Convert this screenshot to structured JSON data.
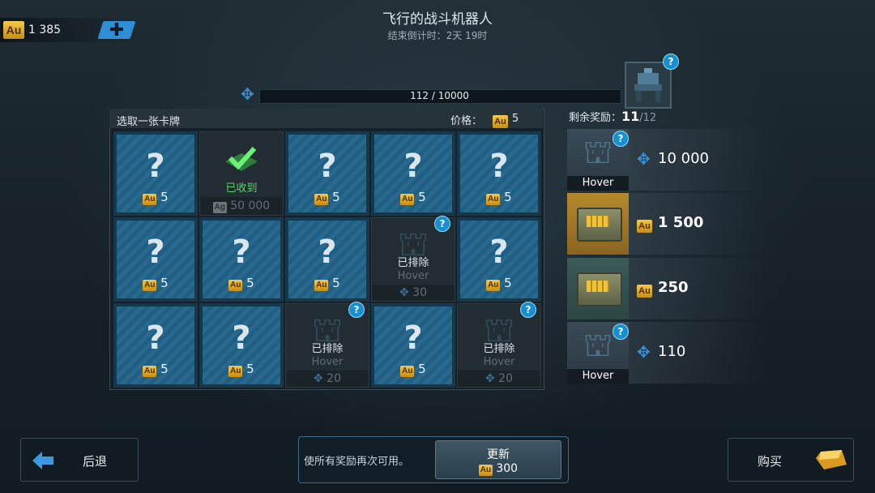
{
  "header": {
    "currency_icon": "Au",
    "currency_amount": "1 385",
    "plus_icon": "plus-icon",
    "title": "飞行的战斗机器人",
    "countdown": "结束倒计时：2天 19时"
  },
  "progress": {
    "text": "112 / 10000",
    "current": 112,
    "max": 10000,
    "icon": "puzzle-piece-icon"
  },
  "card_panel": {
    "title": "选取一张卡牌",
    "price_label": "价格：",
    "price_value": "5",
    "cards": [
      {
        "type": "hidden",
        "cost": "5"
      },
      {
        "type": "collected",
        "label": "已收到",
        "value": "50 000",
        "currency": "Ag"
      },
      {
        "type": "hidden",
        "cost": "5"
      },
      {
        "type": "hidden",
        "cost": "5"
      },
      {
        "type": "hidden",
        "cost": "5"
      },
      {
        "type": "hidden",
        "cost": "5"
      },
      {
        "type": "hidden",
        "cost": "5"
      },
      {
        "type": "hidden",
        "cost": "5"
      },
      {
        "type": "excluded",
        "label": "已排除",
        "name": "Hover",
        "count": "30"
      },
      {
        "type": "hidden",
        "cost": "5"
      },
      {
        "type": "hidden",
        "cost": "5"
      },
      {
        "type": "hidden",
        "cost": "5"
      },
      {
        "type": "excluded",
        "label": "已排除",
        "name": "Hover",
        "count": "20"
      },
      {
        "type": "hidden",
        "cost": "5"
      },
      {
        "type": "excluded",
        "label": "已排除",
        "name": "Hover",
        "count": "20"
      }
    ]
  },
  "rewards": {
    "remaining_label": "剩余奖励：",
    "remaining_count": "11",
    "remaining_total": "/12",
    "items": [
      {
        "thumb": "robot",
        "name": "Hover",
        "icon": "puzzle-piece-icon",
        "value": "10 000"
      },
      {
        "thumb": "crate-gold",
        "icon": "Au",
        "value": "1 500"
      },
      {
        "thumb": "crate-teal",
        "icon": "Au",
        "value": "250"
      },
      {
        "thumb": "robot",
        "name": "Hover",
        "icon": "puzzle-piece-icon",
        "value": "110"
      }
    ]
  },
  "footer": {
    "back_label": "后退",
    "refresh_text": "使所有奖励再次可用。",
    "refresh_label": "更新",
    "refresh_cost": "300",
    "buy_label": "购买"
  },
  "colors": {
    "accent_blue": "#1591d1",
    "gold": "#f0c23c",
    "collected_green": "#5bd36a"
  }
}
